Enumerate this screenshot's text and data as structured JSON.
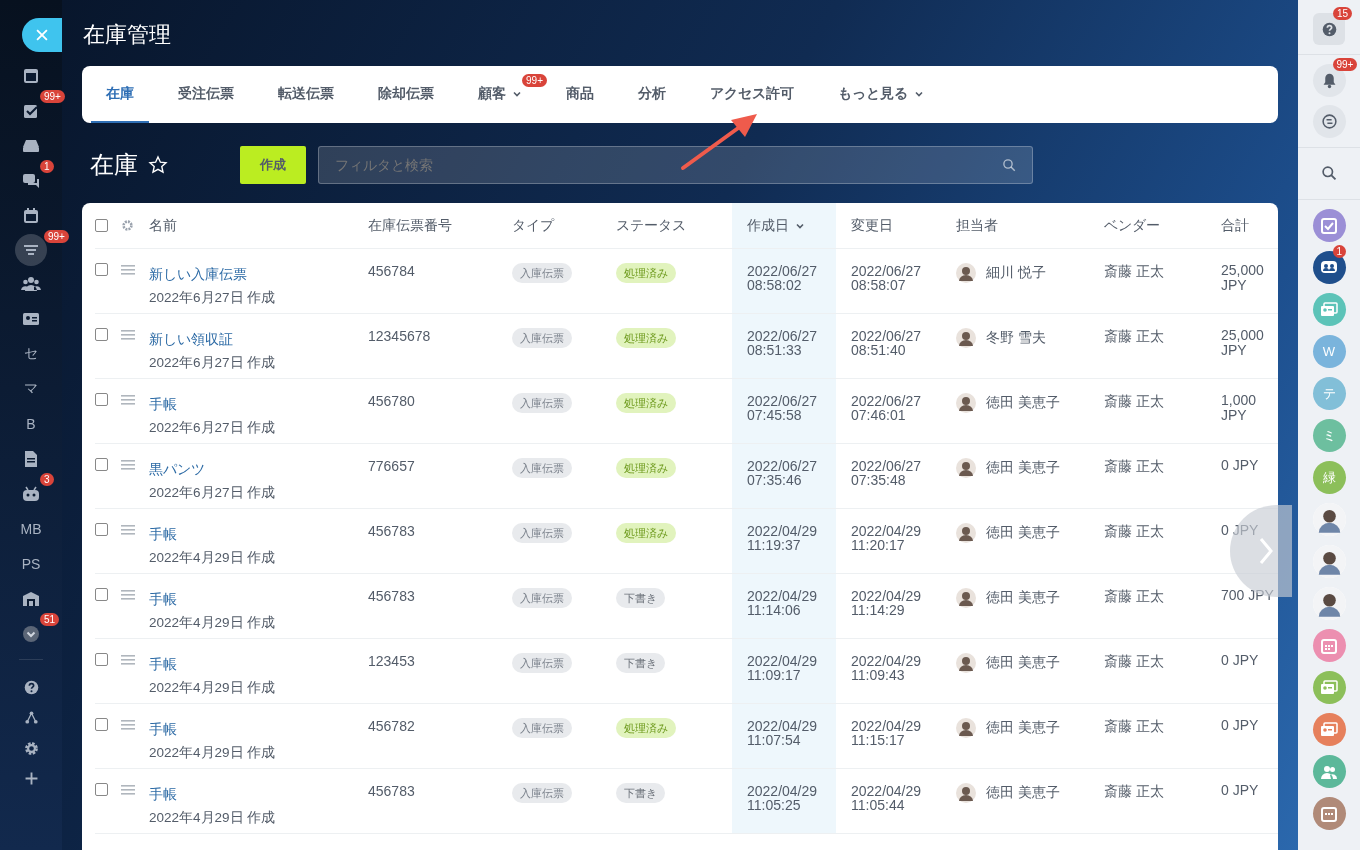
{
  "left_sidebar": {
    "groups": [
      [
        {
          "kind": "icon",
          "selected": false
        },
        {
          "kind": "icon",
          "badge": "99+",
          "selected": false
        },
        {
          "kind": "icon",
          "selected": false
        },
        {
          "kind": "icon",
          "badge": "1",
          "selected": false
        },
        {
          "kind": "icon",
          "selected": false
        },
        {
          "kind": "icon",
          "badge": "99+",
          "selected": true
        },
        {
          "kind": "icon",
          "selected": false
        },
        {
          "kind": "icon",
          "selected": false
        },
        {
          "kind": "text",
          "label": "セ",
          "selected": false
        },
        {
          "kind": "text",
          "label": "マ",
          "selected": false
        },
        {
          "kind": "text",
          "label": "B",
          "selected": false
        },
        {
          "kind": "icon",
          "selected": false
        },
        {
          "kind": "icon",
          "badge": "3",
          "selected": false
        },
        {
          "kind": "text",
          "label": "MB",
          "selected": false
        },
        {
          "kind": "text",
          "label": "PS",
          "selected": false
        },
        {
          "kind": "icon",
          "selected": false
        },
        {
          "kind": "icon",
          "badge": "51",
          "selected": false
        }
      ],
      [
        {
          "kind": "icon",
          "selected": false
        },
        {
          "kind": "icon",
          "selected": false
        },
        {
          "kind": "icon",
          "selected": false
        },
        {
          "kind": "icon",
          "selected": false
        }
      ]
    ]
  },
  "page_title": "在庫管理",
  "tabs": [
    {
      "label": "在庫",
      "selected": true,
      "dropdown": false
    },
    {
      "label": "受注伝票",
      "selected": false,
      "dropdown": false
    },
    {
      "label": "転送伝票",
      "selected": false,
      "dropdown": false
    },
    {
      "label": "除却伝票",
      "selected": false,
      "dropdown": false
    },
    {
      "label": "顧客",
      "selected": false,
      "dropdown": true,
      "badge": "99+"
    },
    {
      "label": "商品",
      "selected": false,
      "dropdown": false
    },
    {
      "label": "分析",
      "selected": false,
      "dropdown": false
    },
    {
      "label": "アクセス許可",
      "selected": false,
      "dropdown": false
    },
    {
      "label": "もっと見る",
      "selected": false,
      "dropdown": true
    }
  ],
  "toolbar": {
    "title": "在庫",
    "favorite": false,
    "create_button": "作成",
    "search": {
      "placeholder": "フィルタと検索"
    }
  },
  "table": {
    "select_all": {
      "checked": false
    },
    "columns": [
      {
        "label": "名前",
        "sorted": false
      },
      {
        "label": "在庫伝票番号",
        "sorted": false
      },
      {
        "label": "タイプ",
        "sorted": false
      },
      {
        "label": "ステータス",
        "sorted": false
      },
      {
        "label": "作成日",
        "sorted": true
      },
      {
        "label": "変更日",
        "sorted": false
      },
      {
        "label": "担当者",
        "sorted": false
      },
      {
        "label": "ベンダー",
        "sorted": false
      },
      {
        "label": "合計",
        "sorted": false
      }
    ],
    "rows": [
      {
        "checked": false,
        "name": "新しい入庫伝票",
        "created_note": "2022年6月27日 作成",
        "number": "456784",
        "type": "入庫伝票",
        "status": {
          "label": "処理済み",
          "kind": "done"
        },
        "created": "2022/06/27 08:58:02",
        "modified": "2022/06/27 08:58:07",
        "assignee": "細川 悦子",
        "vendor": "斎藤 正太",
        "total": "25,000 JPY"
      },
      {
        "checked": false,
        "name": "新しい領収証",
        "created_note": "2022年6月27日 作成",
        "number": "12345678",
        "type": "入庫伝票",
        "status": {
          "label": "処理済み",
          "kind": "done"
        },
        "created": "2022/06/27 08:51:33",
        "modified": "2022/06/27 08:51:40",
        "assignee": "冬野 雪夫",
        "vendor": "斎藤 正太",
        "total": "25,000 JPY"
      },
      {
        "checked": false,
        "name": "手帳",
        "created_note": "2022年6月27日 作成",
        "number": "456780",
        "type": "入庫伝票",
        "status": {
          "label": "処理済み",
          "kind": "done"
        },
        "created": "2022/06/27 07:45:58",
        "modified": "2022/06/27 07:46:01",
        "assignee": "徳田 美恵子",
        "vendor": "斎藤 正太",
        "total": "1,000 JPY"
      },
      {
        "checked": false,
        "name": "黒パンツ",
        "created_note": "2022年6月27日 作成",
        "number": "776657",
        "type": "入庫伝票",
        "status": {
          "label": "処理済み",
          "kind": "done"
        },
        "created": "2022/06/27 07:35:46",
        "modified": "2022/06/27 07:35:48",
        "assignee": "徳田 美恵子",
        "vendor": "斎藤 正太",
        "total": "0 JPY"
      },
      {
        "checked": false,
        "name": "手帳",
        "created_note": "2022年4月29日 作成",
        "number": "456783",
        "type": "入庫伝票",
        "status": {
          "label": "処理済み",
          "kind": "done"
        },
        "created": "2022/04/29 11:19:37",
        "modified": "2022/04/29 11:20:17",
        "assignee": "徳田 美恵子",
        "vendor": "斎藤 正太",
        "total": "0 JPY"
      },
      {
        "checked": false,
        "name": "手帳",
        "created_note": "2022年4月29日 作成",
        "number": "456783",
        "type": "入庫伝票",
        "status": {
          "label": "下書き",
          "kind": "draft"
        },
        "created": "2022/04/29 11:14:06",
        "modified": "2022/04/29 11:14:29",
        "assignee": "徳田 美恵子",
        "vendor": "斎藤 正太",
        "total": "700 JPY"
      },
      {
        "checked": false,
        "name": "手帳",
        "created_note": "2022年4月29日 作成",
        "number": "123453",
        "type": "入庫伝票",
        "status": {
          "label": "下書き",
          "kind": "draft"
        },
        "created": "2022/04/29 11:09:17",
        "modified": "2022/04/29 11:09:43",
        "assignee": "徳田 美恵子",
        "vendor": "斎藤 正太",
        "total": "0 JPY"
      },
      {
        "checked": false,
        "name": "手帳",
        "created_note": "2022年4月29日 作成",
        "number": "456782",
        "type": "入庫伝票",
        "status": {
          "label": "処理済み",
          "kind": "done"
        },
        "created": "2022/04/29 11:07:54",
        "modified": "2022/04/29 11:15:17",
        "assignee": "徳田 美恵子",
        "vendor": "斎藤 正太",
        "total": "0 JPY"
      },
      {
        "checked": false,
        "name": "手帳",
        "created_note": "2022年4月29日 作成",
        "number": "456783",
        "type": "入庫伝票",
        "status": {
          "label": "下書き",
          "kind": "draft"
        },
        "created": "2022/04/29 11:05:25",
        "modified": "2022/04/29 11:05:44",
        "assignee": "徳田 美恵子",
        "vendor": "斎藤 正太",
        "total": "0 JPY"
      }
    ]
  },
  "right_sidebar": {
    "groups": [
      [
        {
          "kind": "icon",
          "badge": "15"
        }
      ],
      [
        {
          "kind": "icon",
          "badge": "99+"
        },
        {
          "kind": "icon"
        }
      ],
      [
        {
          "kind": "icon"
        }
      ],
      [
        {
          "kind": "icon",
          "color": "#9b8fd6"
        },
        {
          "kind": "icon",
          "color": "#1f4f8c",
          "badge": "1"
        },
        {
          "kind": "icon",
          "color": "#5cc3b8"
        },
        {
          "kind": "text",
          "label": "W",
          "color": "#7ab4dc"
        },
        {
          "kind": "text",
          "label": "テ",
          "color": "#82bfd8"
        },
        {
          "kind": "text",
          "label": "ミ",
          "color": "#6dbf9f"
        },
        {
          "kind": "text",
          "label": "緑",
          "color": "#8cbf5a"
        },
        {
          "kind": "photo"
        },
        {
          "kind": "photo"
        },
        {
          "kind": "photo"
        },
        {
          "kind": "icon",
          "color": "#ec8fb0"
        },
        {
          "kind": "icon",
          "color": "#8cbf5a"
        },
        {
          "kind": "icon",
          "color": "#e6805c"
        },
        {
          "kind": "icon",
          "color": "#5cb89a"
        },
        {
          "kind": "icon",
          "color": "#b08a78"
        }
      ]
    ]
  }
}
